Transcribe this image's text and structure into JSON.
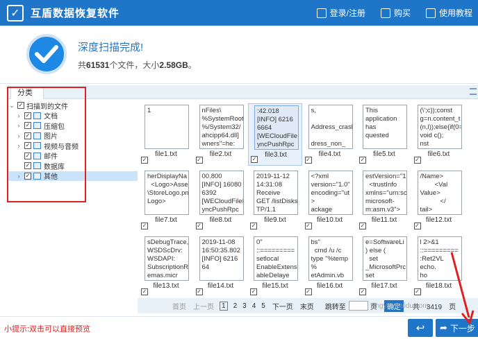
{
  "app": {
    "title": "互盾数据恢复软件",
    "logo_glyph": "✓",
    "actions": [
      {
        "label": "登录/注册",
        "icon": "login-icon"
      },
      {
        "label": "购买",
        "icon": "cart-icon"
      },
      {
        "label": "使用教程",
        "icon": "book-icon"
      }
    ]
  },
  "status": {
    "title": "深度扫描完成!",
    "prefix": "共",
    "file_count": "61531",
    "mid": "个文件，大小",
    "size": "2.58GB",
    "suffix": "。"
  },
  "left_panel": {
    "tab_label": "分类",
    "root": {
      "label": "扫描到的文件",
      "checked": true,
      "expanded": true
    },
    "items": [
      {
        "label": "文档",
        "checked": true,
        "icon": "document-icon"
      },
      {
        "label": "压缩包",
        "checked": true,
        "icon": "archive-icon"
      },
      {
        "label": "图片",
        "checked": true,
        "icon": "image-icon"
      },
      {
        "label": "视频与音频",
        "checked": true,
        "icon": "video-icon"
      },
      {
        "label": "邮件",
        "checked": true,
        "icon": "mail-icon"
      },
      {
        "label": "数据库",
        "checked": true,
        "icon": "database-icon"
      },
      {
        "label": "其他",
        "checked": true,
        "icon": "other-icon",
        "selected": true
      }
    ]
  },
  "files": [
    {
      "name": "file1.txt",
      "preview": "1",
      "checked": true
    },
    {
      "name": "file2.txt",
      "preview": "nFiles\\\n%SystemRoot\n%/System32/\nahcipp64.dll]\nwners\"=he:",
      "checked": true
    },
    {
      "name": "file3.txt",
      "preview": ":42.018\n[INFO] 6216\n6664\n[WECloudFileI\nyncPushRpc",
      "checked": true,
      "selected": true
    },
    {
      "name": "file4.txt",
      "preview": "s,\n\nAddress_crasl\n\ndress_non_",
      "checked": true
    },
    {
      "name": "file5.txt",
      "preview": "This\napplication\nhas\nquested",
      "checked": true
    },
    {
      "name": "file6.txt",
      "preview": "(\\';c));const\ng=n.content_t\n(n,l));else{if(0=\nvoid c();\nnst",
      "checked": true
    },
    {
      "name": "file7.txt",
      "preview": "herDisplayNa\n  <Logo>Asse\n\\StoreLogo.pn\nLogo>",
      "checked": true
    },
    {
      "name": "file8.txt",
      "preview": "00.800\n[INFO] 16080\n6392\n[WECloudFileI\nyncPushRpc",
      "checked": true
    },
    {
      "name": "file9.txt",
      "preview": "2019-11-12\n14:31:08\nReceive\nGET /listDisks\nTP/1.1",
      "checked": true
    },
    {
      "name": "file10.txt",
      "preview": "<?xml\nversion=\"1.0\"\nencoding=\"ut\n>\nackage",
      "checked": true
    },
    {
      "name": "file11.txt",
      "preview": "estVersion=\"1\n  <trustInfo\nxmlns=\"urn:sc\nmicrosoft-\nm:asm.v3\">",
      "checked": true
    },
    {
      "name": "file12.txt",
      "preview": "/Name>\n        <Val\nValue>\n           </\ntail>",
      "checked": true
    },
    {
      "name": "file13.txt",
      "preview": "sDebugTrace,\nWSDScDrv:\nWSDAPI:\nSubscriptionR\nemas.micr",
      "checked": true
    },
    {
      "name": "file14.txt",
      "preview": "2019-11-08\n16:50:35.802\n[INFO] 6216\n64",
      "checked": true
    },
    {
      "name": "file15.txt",
      "preview": "0\"\n::=========\nsetlocal\nEnableExtensi\nableDelaye",
      "checked": true
    },
    {
      "name": "file16.txt",
      "preview": "bs\"\n  cmd /u /c\ntype \"%temp\n%\netAdmin.vb",
      "checked": true
    },
    {
      "name": "file17.txt",
      "preview": "e=SoftwareLi\n) else (\n  set\n_MicrosoftPrc\nset",
      "checked": true
    },
    {
      "name": "file18.txt",
      "preview": "l 2>&1\n::=========\n:Ret2VL\necho.\nho",
      "checked": true
    }
  ],
  "pager": {
    "first": "首页",
    "prev": "上一页",
    "pages": [
      "1",
      "2",
      "3",
      "4",
      "5"
    ],
    "current_page": "1",
    "next": "下一页",
    "last": "末页",
    "goto_label": "跳转至",
    "page_unit": "页",
    "go_button": "确定",
    "total_prefix": "共",
    "total_pages": "3419",
    "total_suffix": "页"
  },
  "bottom": {
    "hint": "小提示:双击可以直接预览",
    "back_glyph": "↩",
    "next_label": "下一步",
    "next_glyph": "➦"
  },
  "watermark": "jingyan.baidu.com"
}
